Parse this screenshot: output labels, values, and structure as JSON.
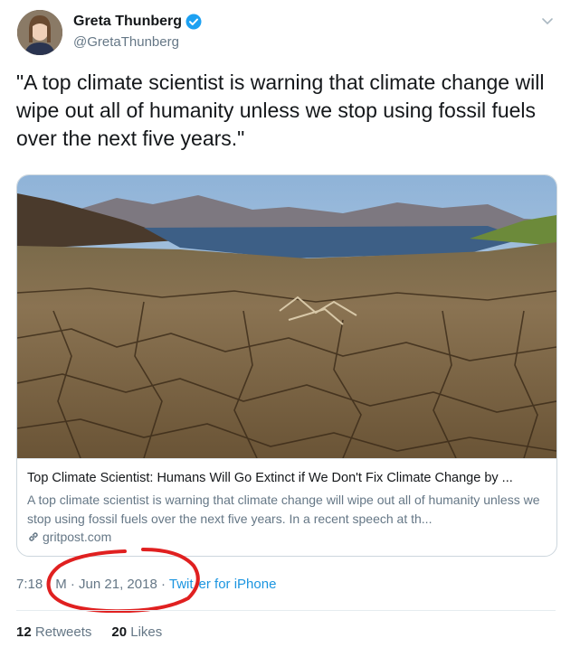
{
  "user": {
    "display_name": "Greta Thunberg",
    "handle": "@GretaThunberg",
    "verified_color": "#1da1f2"
  },
  "tweet": {
    "text": "\"A top climate scientist is warning that climate change will wipe out all of humanity unless we stop using fossil fuels over the next five years.\""
  },
  "card": {
    "title": "Top Climate Scientist: Humans Will Go Extinct if We Don't Fix Climate Change by ...",
    "description": "A top climate scientist is warning that climate change will wipe out all of humanity unless we stop using fossil fuels over the next five years. In a recent speech at th...",
    "domain": "gritpost.com"
  },
  "meta": {
    "time": "7:18",
    "time_suffix_partial": "M",
    "date": "Jun 21, 2018",
    "source_partial_a": "Twit",
    "source_partial_b": "er for iPhone",
    "annotation_color": "#e02020"
  },
  "stats": {
    "retweets_count": "12",
    "retweets_label": "Retweets",
    "likes_count": "20",
    "likes_label": "Likes"
  },
  "icons": [
    "verified-badge-icon",
    "caret-down-icon",
    "link-icon"
  ]
}
